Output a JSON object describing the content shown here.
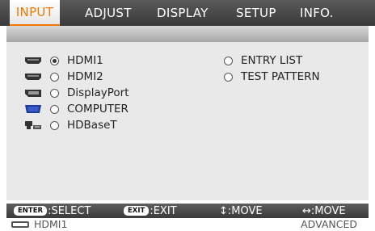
{
  "tabs": [
    {
      "label": "INPUT",
      "active": true
    },
    {
      "label": "ADJUST",
      "active": false
    },
    {
      "label": "DISPLAY",
      "active": false
    },
    {
      "label": "SETUP",
      "active": false
    },
    {
      "label": "INFO.",
      "active": false
    }
  ],
  "inputs": [
    {
      "label": "HDMI1",
      "icon": "hdmi-port-icon",
      "selected": true
    },
    {
      "label": "HDMI2",
      "icon": "hdmi-port-icon",
      "selected": false
    },
    {
      "label": "DisplayPort",
      "icon": "displayport-icon",
      "selected": false
    },
    {
      "label": "COMPUTER",
      "icon": "vga-port-icon",
      "selected": false
    },
    {
      "label": "HDBaseT",
      "icon": "hdbaset-icon",
      "selected": false
    }
  ],
  "options": [
    {
      "label": "ENTRY LIST"
    },
    {
      "label": "TEST PATTERN"
    }
  ],
  "hints": {
    "enter_key": "ENTER",
    "enter_text": ":SELECT",
    "exit_key": "EXIT",
    "exit_text": ":EXIT",
    "move_ud": "↕:MOVE",
    "move_lr": "↔:MOVE"
  },
  "status": {
    "source": "HDMI1",
    "mode": "ADVANCED"
  },
  "colors": {
    "accent": "#f07800",
    "vga_blue": "#1e3c9a"
  }
}
